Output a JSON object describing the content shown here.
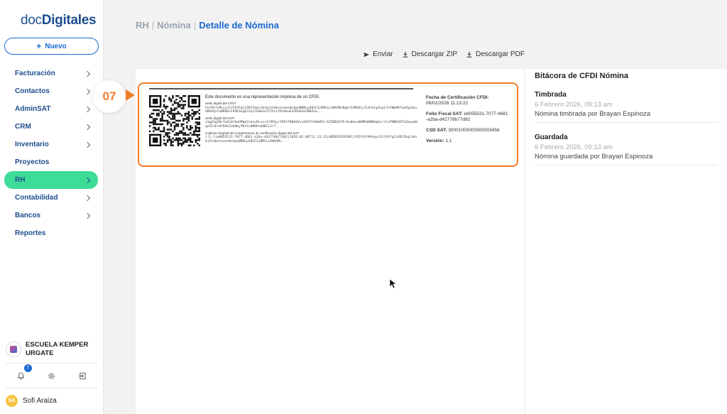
{
  "logo": {
    "part1": "doc",
    "part2": "Digitales"
  },
  "new_button": {
    "label": "Nuevo"
  },
  "nav": [
    {
      "label": "Facturación",
      "chevron": true
    },
    {
      "label": "Contactos",
      "chevron": true
    },
    {
      "label": "AdminSAT",
      "chevron": true
    },
    {
      "label": "CRM",
      "chevron": true
    },
    {
      "label": "Inventario",
      "chevron": true
    },
    {
      "label": "Proyectos",
      "chevron": false
    },
    {
      "label": "RH",
      "chevron": true,
      "active": true
    },
    {
      "label": "Contabilidad",
      "chevron": true
    },
    {
      "label": "Bancos",
      "chevron": true
    },
    {
      "label": "Reportes",
      "chevron": false
    }
  ],
  "organization": {
    "name_line1": "ESCUELA KEMPER",
    "name_line2": "URGATE"
  },
  "notifications": {
    "count": "7"
  },
  "user": {
    "initials": "SA",
    "name": "Sofi Araiza"
  },
  "breadcrumb": {
    "part1": "RH",
    "part2": "Nómina",
    "current": "Detalle de Nómina"
  },
  "actions": {
    "send": "Enviar",
    "download_zip": "Descargar ZIP",
    "download_pdf": "Descargar PDF"
  },
  "step_marker": {
    "number": "07"
  },
  "accent_colors": {
    "brand": "#1a6ad1",
    "active_nav": "#3ddc97",
    "highlight": "#f07c2a"
  },
  "invoice": {
    "lead": "Este documento es una representación impresa de un CFDI.",
    "sello_cfdi_label": "Sello digital del CFDI:",
    "sello_cfdi": "FkrRkfrMnjxJ1JfbYFg2zXDYZkglaVsbjh1dUxtuvmsWcbpoNRBLpS0CE3jBMCLLXNXXMcNqbrS4MVOjcIL8rbCpXxpL7nfNmHRfxmVg1dxuARHVQzYuBKRD+FR5K3ogDJzGy7eHm2aTI7hcLYRsOeab35RaEbSaM0Zea...",
    "sello_sat_label": "Sello digital del SAT:",
    "sello_sat": "z3gb5gINrfoOcDrKwOPWpYvdvu9Lso+2r9EGy+5DVlFR0bVVcuXXEThtHmH5C+SZ5BE0XfEr8x0kwi0KMDdDNMmqhcritvPHNH3HTGZwLpeWqeIFuE+RCRVmZobBmyTNrEzbMBPxU8BCL2rT...",
    "cadena_label": "Cadena Original del complemento de certificación digital del SAT:",
    "cadena": "||1.1|e8055531-7077-4681-a2ba-d42778b77d82|2026-02-06T11:13:22|ABDEGFR1938C|FEEF4frMnhqvJ1JfbYFg2zXDYZkglaVsbjh1dUxtuvmsWcbpoNRBLpS0CE3jBMCLLXNXXMc...",
    "cert_date_label": "Fecha de Certificación CFDI:",
    "cert_date": "06/02/2026 11:13:22",
    "folio_label": "Folio Fiscal SAT:",
    "folio_part1": "e8055531-7077-4681",
    "folio_part2": "-a2ba-d42778b77d82",
    "csd_label": "CSD SAT:",
    "csd": "30001000000500003456",
    "version_label": "Versión:",
    "version": "1.1"
  },
  "bitacora": {
    "title": "Bitácora de CFDI Nómina",
    "events": [
      {
        "title": "Timbrada",
        "date": "6 Febrero 2026, 09:13 am",
        "desc": "Nómina timbrada por Brayan Espinoza"
      },
      {
        "title": "Guardada",
        "date": "6 Febrero 2026, 09:13 am",
        "desc": "Nómina guardada por Brayan Espinoza"
      }
    ]
  }
}
